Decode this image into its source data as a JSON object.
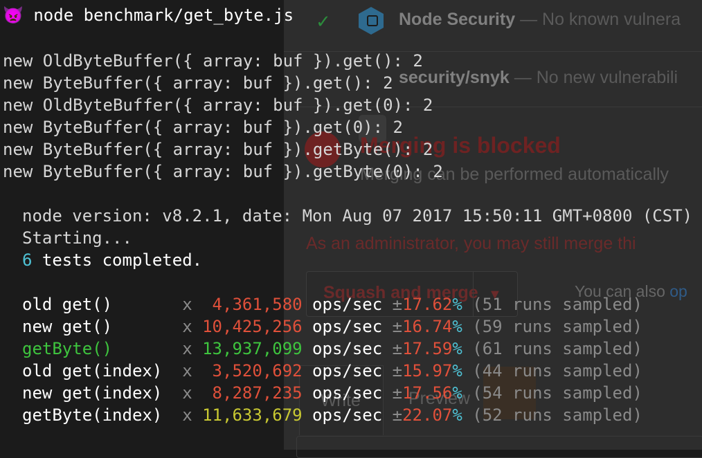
{
  "background_page": {
    "checks": [
      {
        "name": "Node Security",
        "description": "— No known vulnera"
      },
      {
        "name": "security/snyk",
        "description": "— No new vulnerabili"
      }
    ],
    "merge_title": "Merging is blocked",
    "merge_subtitle": "Merging can be performed automatically",
    "admin_notice": "As an administrator, you may still merge thi",
    "squash_button": "Squash and merge",
    "also_text": "You can also ",
    "also_link": "op",
    "tab_write": "Write",
    "tab_preview": "Preview"
  },
  "terminal": {
    "prompt_icon": "👿",
    "command": "node benchmark/get_byte.js",
    "outputs": [
      {
        "expr": "new OldByteBuffer({ array: buf }).get()",
        "result": ": 2"
      },
      {
        "expr": "new ByteBuffer({ array: buf }).get()",
        "result": ": 2"
      },
      {
        "expr": "new OldByteBuffer({ array: buf }).get(0)",
        "result": ": 2"
      },
      {
        "expr": "new ByteBuffer({ array: buf }).get(0)",
        "result": ": 2"
      },
      {
        "expr": "new ByteBuffer({ array: buf }).getByte()",
        "result": ": 2"
      },
      {
        "expr": "new ByteBuffer({ array: buf }).getByte(0)",
        "result": ": 2"
      }
    ],
    "node_info": "node version: v8.2.1, date: Mon Aug 07 2017 15:50:11 GMT+0800 (CST)",
    "starting": "Starting...",
    "tests_count": "6",
    "tests_text": " tests completed.",
    "results": [
      {
        "name": "old get()      ",
        "x": "x",
        "ops": "  4,361,580",
        "unit": " ops/sec ",
        "pm": "±",
        "rme": "17.62",
        "pct": "%",
        "runs": " (51 runs sampled)"
      },
      {
        "name": "new get()      ",
        "x": "x",
        "ops": " 10,425,256",
        "unit": " ops/sec ",
        "pm": "±",
        "rme": "16.74",
        "pct": "%",
        "runs": " (59 runs sampled)"
      },
      {
        "name": "getByte()      ",
        "x": "x",
        "ops": " 13,937,099",
        "unit": " ops/sec ",
        "pm": "±",
        "rme": "17.59",
        "pct": "%",
        "runs": " (61 runs sampled)"
      },
      {
        "name": "old get(index) ",
        "x": "x",
        "ops": "  3,520,692",
        "unit": " ops/sec ",
        "pm": "±",
        "rme": "15.97",
        "pct": "%",
        "runs": " (44 runs sampled)"
      },
      {
        "name": "new get(index) ",
        "x": "x",
        "ops": "  8,287,235",
        "unit": " ops/sec ",
        "pm": "±",
        "rme": "17.56",
        "pct": "%",
        "runs": " (54 runs sampled)"
      },
      {
        "name": "getByte(index) ",
        "x": "x",
        "ops": " 11,633,679",
        "unit": " ops/sec ",
        "pm": "±",
        "rme": "22.07",
        "pct": "%",
        "runs": " (52 runs sampled)"
      }
    ]
  }
}
